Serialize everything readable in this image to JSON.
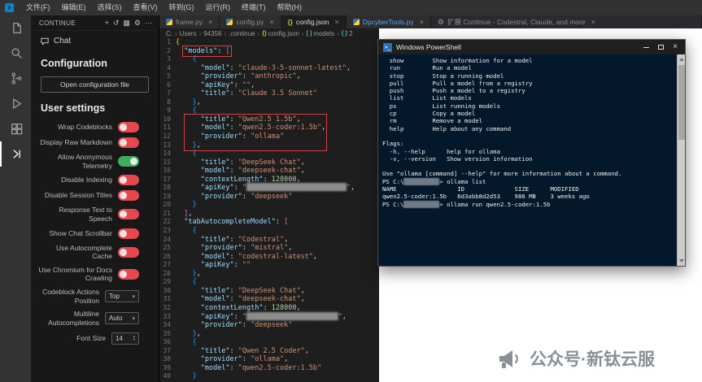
{
  "titlebar": {
    "menus": [
      "文件(F)",
      "编辑(E)",
      "选择(S)",
      "查看(V)",
      "转到(G)",
      "运行(R)",
      "终端(T)",
      "帮助(H)"
    ]
  },
  "activitybar": {
    "icons": [
      "explorer",
      "search",
      "source-control",
      "run-and-debug",
      "extensions",
      "continue"
    ],
    "active": "continue"
  },
  "sidebar": {
    "panel_title": "CONTINUE",
    "header_icons": [
      "plus-icon",
      "history-icon",
      "layout-icon",
      "gear-icon",
      "more-icon"
    ],
    "chat_label": "Chat",
    "configuration_heading": "Configuration",
    "open_config_button": "Open configuration file",
    "user_settings_heading": "User settings",
    "toggle_colors": {
      "on": "#3dae5b",
      "off": "#e5484d"
    },
    "settings": [
      {
        "label": "Wrap Codeblocks",
        "type": "toggle",
        "state": "off"
      },
      {
        "label": "Display Raw Markdown",
        "type": "toggle",
        "state": "off"
      },
      {
        "label": "Allow Anonymous Telemetry",
        "type": "toggle",
        "state": "on"
      },
      {
        "label": "Disable Indexing",
        "type": "toggle",
        "state": "off"
      },
      {
        "label": "Disable Session Titles",
        "type": "toggle",
        "state": "off"
      },
      {
        "label": "Response Text to Speech",
        "type": "toggle",
        "state": "off"
      },
      {
        "label": "Show Chat Scrollbar",
        "type": "toggle",
        "state": "off"
      },
      {
        "label": "Use Autocomplete Cache",
        "type": "toggle",
        "state": "off"
      },
      {
        "label": "Use Chromium for Docs Crawling",
        "type": "toggle",
        "state": "off"
      },
      {
        "label": "Codeblock Actions Position",
        "type": "select",
        "value": "Top"
      },
      {
        "label": "Multiline Autocompletions",
        "type": "select",
        "value": "Auto"
      },
      {
        "label": "Font Size",
        "type": "number",
        "value": "14"
      }
    ]
  },
  "tabs": [
    {
      "label": "frame.py",
      "icon": "python"
    },
    {
      "label": "config.py",
      "icon": "python"
    },
    {
      "label": "config.json",
      "icon": "json",
      "active": true
    },
    {
      "label": "DpcyberTools.py",
      "icon": "python",
      "highlight": true
    },
    {
      "label": "扩展 Continue - Codestral, Claude, and more",
      "icon": "extension",
      "stretch": true
    }
  ],
  "breadcrumb": [
    {
      "label": "C:"
    },
    {
      "label": "Users"
    },
    {
      "label": "94356"
    },
    {
      "label": ".continue"
    },
    {
      "label": "config.json",
      "icon": "json"
    },
    {
      "label": "models",
      "icon": "array"
    },
    {
      "label": "2",
      "icon": "object"
    }
  ],
  "editor": {
    "lines": [
      {
        "segs": [
          [
            "{",
            "b1"
          ]
        ]
      },
      {
        "segs": [
          [
            "  ",
            "t"
          ],
          [
            "\"models\"",
            "k"
          ],
          [
            ": ",
            "p"
          ],
          [
            "[",
            "b2"
          ]
        ],
        "boxed": true
      },
      {
        "segs": [
          [
            "    ",
            "t"
          ],
          [
            "{",
            "b3"
          ]
        ]
      },
      {
        "segs": [
          [
            "      ",
            "t"
          ],
          [
            "\"model\"",
            "k"
          ],
          [
            ": ",
            "p"
          ],
          [
            "\"claude-3-5-sonnet-latest\"",
            "s"
          ],
          [
            ",",
            "p"
          ]
        ]
      },
      {
        "segs": [
          [
            "      ",
            "t"
          ],
          [
            "\"provider\"",
            "k"
          ],
          [
            ": ",
            "p"
          ],
          [
            "\"anthropic\"",
            "s"
          ],
          [
            ",",
            "p"
          ]
        ]
      },
      {
        "segs": [
          [
            "      ",
            "t"
          ],
          [
            "\"apiKey\"",
            "k"
          ],
          [
            ": ",
            "p"
          ],
          [
            "\"\"",
            "s"
          ],
          [
            ",",
            "p"
          ]
        ]
      },
      {
        "segs": [
          [
            "      ",
            "t"
          ],
          [
            "\"title\"",
            "k"
          ],
          [
            ": ",
            "p"
          ],
          [
            "\"Claude 3.5 Sonnet\"",
            "s"
          ]
        ]
      },
      {
        "segs": [
          [
            "    ",
            "t"
          ],
          [
            "}",
            "b3"
          ],
          [
            ",",
            "p"
          ]
        ]
      },
      {
        "segs": [
          [
            "    ",
            "t"
          ],
          [
            "{",
            "b3"
          ]
        ]
      },
      {
        "segs": [
          [
            "      ",
            "t"
          ],
          [
            "\"title\"",
            "k"
          ],
          [
            ": ",
            "p"
          ],
          [
            "\"Qwen2.5 1.5b\"",
            "s"
          ],
          [
            ",",
            "p"
          ]
        ]
      },
      {
        "segs": [
          [
            "      ",
            "t"
          ],
          [
            "\"model\"",
            "k"
          ],
          [
            ": ",
            "p"
          ],
          [
            "\"qwen2.5-coder:1.5b\"",
            "s"
          ],
          [
            ",",
            "p"
          ]
        ]
      },
      {
        "segs": [
          [
            "      ",
            "t"
          ],
          [
            "\"provider\"",
            "k"
          ],
          [
            ": ",
            "p"
          ],
          [
            "\"ollama\"",
            "s"
          ]
        ]
      },
      {
        "segs": [
          [
            "    ",
            "t"
          ],
          [
            "}",
            "b3"
          ],
          [
            ",",
            "p"
          ]
        ]
      },
      {
        "segs": [
          [
            "    ",
            "t"
          ],
          [
            "{",
            "b3"
          ]
        ]
      },
      {
        "segs": [
          [
            "      ",
            "t"
          ],
          [
            "\"title\"",
            "k"
          ],
          [
            ": ",
            "p"
          ],
          [
            "\"DeepSeek Chat\"",
            "s"
          ],
          [
            ",",
            "p"
          ]
        ]
      },
      {
        "segs": [
          [
            "      ",
            "t"
          ],
          [
            "\"model\"",
            "k"
          ],
          [
            ": ",
            "p"
          ],
          [
            "\"deepseek-chat\"",
            "s"
          ],
          [
            ",",
            "p"
          ]
        ]
      },
      {
        "segs": [
          [
            "      ",
            "t"
          ],
          [
            "\"contextLength\"",
            "k"
          ],
          [
            ": ",
            "p"
          ],
          [
            "128000",
            "n"
          ],
          [
            ",",
            "p"
          ]
        ]
      },
      {
        "segs": [
          [
            "      ",
            "t"
          ],
          [
            "\"apiKey\"",
            "k"
          ],
          [
            ": ",
            "p"
          ],
          [
            "\"",
            "s"
          ],
          [
            "████████████████████████",
            "r"
          ],
          [
            "\"",
            "s"
          ],
          [
            ",",
            "p"
          ]
        ]
      },
      {
        "segs": [
          [
            "      ",
            "t"
          ],
          [
            "\"provider\"",
            "k"
          ],
          [
            ": ",
            "p"
          ],
          [
            "\"deepseek\"",
            "s"
          ]
        ]
      },
      {
        "segs": [
          [
            "    ",
            "t"
          ],
          [
            "}",
            "b3"
          ]
        ]
      },
      {
        "segs": [
          [
            "  ",
            "t"
          ],
          [
            "]",
            "b2"
          ],
          [
            ",",
            "p"
          ]
        ]
      },
      {
        "segs": [
          [
            "  ",
            "t"
          ],
          [
            "\"tabAutocompleteModel\"",
            "k"
          ],
          [
            ": ",
            "p"
          ],
          [
            "[",
            "b2"
          ]
        ]
      },
      {
        "segs": [
          [
            "    ",
            "t"
          ],
          [
            "{",
            "b3"
          ]
        ]
      },
      {
        "segs": [
          [
            "      ",
            "t"
          ],
          [
            "\"title\"",
            "k"
          ],
          [
            ": ",
            "p"
          ],
          [
            "\"Codestral\"",
            "s"
          ],
          [
            ",",
            "p"
          ]
        ]
      },
      {
        "segs": [
          [
            "      ",
            "t"
          ],
          [
            "\"provider\"",
            "k"
          ],
          [
            ": ",
            "p"
          ],
          [
            "\"mistral\"",
            "s"
          ],
          [
            ",",
            "p"
          ]
        ]
      },
      {
        "segs": [
          [
            "      ",
            "t"
          ],
          [
            "\"model\"",
            "k"
          ],
          [
            ": ",
            "p"
          ],
          [
            "\"codestral-latest\"",
            "s"
          ],
          [
            ",",
            "p"
          ]
        ]
      },
      {
        "segs": [
          [
            "      ",
            "t"
          ],
          [
            "\"apiKey\"",
            "k"
          ],
          [
            ": ",
            "p"
          ],
          [
            "\"\"",
            "s"
          ]
        ]
      },
      {
        "segs": [
          [
            "    ",
            "t"
          ],
          [
            "}",
            "b3"
          ],
          [
            ",",
            "p"
          ]
        ]
      },
      {
        "segs": [
          [
            "    ",
            "t"
          ],
          [
            "{",
            "b3"
          ]
        ]
      },
      {
        "segs": [
          [
            "      ",
            "t"
          ],
          [
            "\"title\"",
            "k"
          ],
          [
            ": ",
            "p"
          ],
          [
            "\"DeepSeek Chat\"",
            "s"
          ],
          [
            ",",
            "p"
          ]
        ]
      },
      {
        "segs": [
          [
            "      ",
            "t"
          ],
          [
            "\"model\"",
            "k"
          ],
          [
            ": ",
            "p"
          ],
          [
            "\"deepseek-chat\"",
            "s"
          ],
          [
            ",",
            "p"
          ]
        ]
      },
      {
        "segs": [
          [
            "      ",
            "t"
          ],
          [
            "\"contextLength\"",
            "k"
          ],
          [
            ": ",
            "p"
          ],
          [
            "128000",
            "n"
          ],
          [
            ",",
            "p"
          ]
        ]
      },
      {
        "segs": [
          [
            "      ",
            "t"
          ],
          [
            "\"apiKey\"",
            "k"
          ],
          [
            ": ",
            "p"
          ],
          [
            "\"",
            "s"
          ],
          [
            "██████████████████████",
            "r"
          ],
          [
            "\"",
            "s"
          ],
          [
            ",",
            "p"
          ]
        ]
      },
      {
        "segs": [
          [
            "      ",
            "t"
          ],
          [
            "\"provider\"",
            "k"
          ],
          [
            ": ",
            "p"
          ],
          [
            "\"deepseek\"",
            "s"
          ]
        ]
      },
      {
        "segs": [
          [
            "    ",
            "t"
          ],
          [
            "}",
            "b3"
          ],
          [
            ",",
            "p"
          ]
        ]
      },
      {
        "segs": [
          [
            "    ",
            "t"
          ],
          [
            "{",
            "b3"
          ]
        ]
      },
      {
        "segs": [
          [
            "      ",
            "t"
          ],
          [
            "\"title\"",
            "k"
          ],
          [
            ": ",
            "p"
          ],
          [
            "\"Qwen 2.5 Coder\"",
            "s"
          ],
          [
            ",",
            "p"
          ]
        ]
      },
      {
        "segs": [
          [
            "      ",
            "t"
          ],
          [
            "\"provider\"",
            "k"
          ],
          [
            ": ",
            "p"
          ],
          [
            "\"ollama\"",
            "s"
          ],
          [
            ",",
            "p"
          ]
        ]
      },
      {
        "segs": [
          [
            "      ",
            "t"
          ],
          [
            "\"model\"",
            "k"
          ],
          [
            ": ",
            "p"
          ],
          [
            "\"qwen2.5-coder:1.5b\"",
            "s"
          ]
        ]
      },
      {
        "segs": [
          [
            "    ",
            "t"
          ],
          [
            "}",
            "b3"
          ]
        ]
      }
    ]
  },
  "terminal": {
    "window_title": "Windows PowerShell",
    "lines": [
      [
        [
          "  show        Show information for a model",
          "t"
        ]
      ],
      [
        [
          "  run         Run a model",
          "t"
        ]
      ],
      [
        [
          "  stop        Stop a running model",
          "t"
        ]
      ],
      [
        [
          "  pull        Pull a model from a registry",
          "t"
        ]
      ],
      [
        [
          "  push        Push a model to a registry",
          "t"
        ]
      ],
      [
        [
          "  list        List models",
          "t"
        ]
      ],
      [
        [
          "  ps          List running models",
          "t"
        ]
      ],
      [
        [
          "  cp          Copy a model",
          "t"
        ]
      ],
      [
        [
          "  rm          Remove a model",
          "t"
        ]
      ],
      [
        [
          "  help        Help about any command",
          "t"
        ]
      ],
      [
        [
          "",
          "t"
        ]
      ],
      [
        [
          "Flags:",
          "t"
        ]
      ],
      [
        [
          "  -h, --help      help for ollama",
          "t"
        ]
      ],
      [
        [
          "  -v, --version   Show version information",
          "t"
        ]
      ],
      [
        [
          "",
          "t"
        ]
      ],
      [
        [
          "Use \"ollama [command] --help\" for more information about a command.",
          "t"
        ]
      ],
      [
        [
          "PS C:\\",
          "t"
        ],
        [
          "██████████",
          "r"
        ],
        [
          "> ollama list",
          "t"
        ]
      ],
      [
        [
          "NAME                 ID              SIZE      MODIFIED",
          "t"
        ]
      ],
      [
        [
          "qwen2.5-coder:1.5b   6d3abb8d2d53    986 MB    3 weeks ago",
          "t"
        ]
      ],
      [
        [
          "PS C:\\",
          "t"
        ],
        [
          "██████████",
          "r"
        ],
        [
          "> ollama run qwen2.5-coder:1.5b",
          "t"
        ]
      ]
    ]
  },
  "watermark": {
    "text": "公众号·新钛云服"
  }
}
